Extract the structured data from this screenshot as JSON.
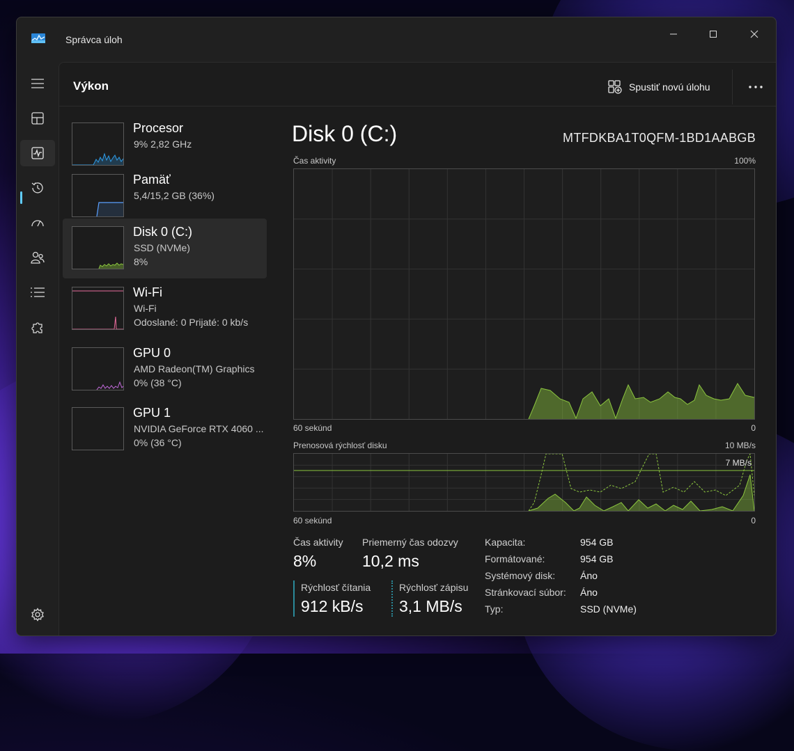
{
  "window": {
    "title": "Správca úloh"
  },
  "header": {
    "title": "Výkon",
    "new_task_label": "Spustiť novú úlohu"
  },
  "devices": [
    {
      "name": "Procesor",
      "line1": "9% 2,82 GHz",
      "line2": ""
    },
    {
      "name": "Pamäť",
      "line1": "5,4/15,2 GB (36%)",
      "line2": ""
    },
    {
      "name": "Disk 0 (C:)",
      "line1": "SSD (NVMe)",
      "line2": "8%"
    },
    {
      "name": "Wi-Fi",
      "line1": "Wi-Fi",
      "line2": "Odoslané: 0 Prijaté: 0 kb/s"
    },
    {
      "name": "GPU 0",
      "line1": "AMD Radeon(TM) Graphics",
      "line2": "0% (38 °C)"
    },
    {
      "name": "GPU 1",
      "line1": "NVIDIA GeForce RTX 4060 ...",
      "line2": "0% (36 °C)"
    }
  ],
  "perf": {
    "title": "Disk 0 (C:)",
    "model": "MTFDKBA1T0QFM-1BD1AABGB",
    "graph1": {
      "label": "Čas aktivity",
      "max": "100%",
      "time_label": "60 sekúnd",
      "min": "0"
    },
    "graph2": {
      "label": "Prenosová rýchlosť disku",
      "max": "10 MB/s",
      "line_label": "7 MB/s",
      "time_label": "60 sekúnd",
      "min": "0"
    },
    "stats": {
      "active_time_label": "Čas aktivity",
      "active_time_value": "8%",
      "response_label": "Priemerný čas odozvy",
      "response_value": "10,2 ms",
      "read_label": "Rýchlosť čítania",
      "read_value": "912 kB/s",
      "write_label": "Rýchlosť zápisu",
      "write_value": "3,1 MB/s"
    },
    "details": [
      {
        "k": "Kapacita:",
        "v": "954 GB"
      },
      {
        "k": "Formátované:",
        "v": "954 GB"
      },
      {
        "k": "Systémový disk:",
        "v": "Áno"
      },
      {
        "k": "Stránkovací súbor:",
        "v": "Áno"
      },
      {
        "k": "Typ:",
        "v": "SSD (NVMe)"
      }
    ]
  },
  "colors": {
    "accent": "#60cdff",
    "disk": "#8cc63f",
    "cpu": "#2e9be6",
    "memory": "#5aa0ff",
    "wifi": "#e86b9c",
    "gpu": "#c36bdc"
  }
}
